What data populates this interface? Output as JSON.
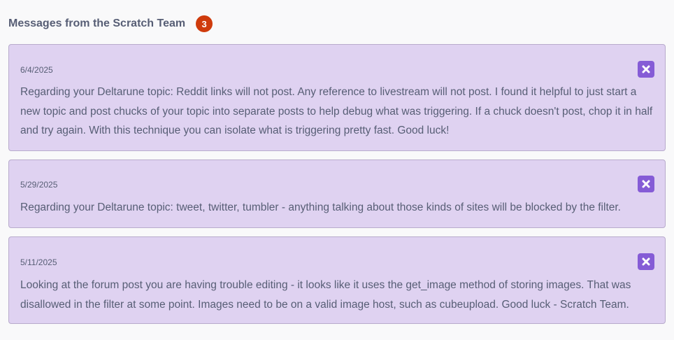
{
  "header": {
    "title": "Messages from the Scratch Team",
    "count": "3"
  },
  "messages": [
    {
      "date": "6/4/2025",
      "text": "Regarding your Deltarune topic: Reddit links will not post. Any reference to livestream will not post. I found it helpful to just start a new topic and post chucks of your topic into separate posts to help debug what was triggering. If a chuck doesn't post, chop it in half and try again. With this technique you can isolate what is triggering pretty fast. Good luck!"
    },
    {
      "date": "5/29/2025",
      "text": "Regarding your Deltarune topic: tweet, twitter, tumbler - anything talking about those kinds of sites will be blocked by the filter."
    },
    {
      "date": "5/11/2025",
      "text": "Looking at the forum post you are having trouble editing - it looks like it uses the get_image method of storing images. That was disallowed in the filter at some point. Images need to be on a valid image host, such as cubeupload. Good luck - Scratch Team."
    }
  ],
  "icons": {
    "dismiss": "close-icon"
  },
  "colors": {
    "message_background": "#dfd2f1",
    "message_border": "#b8abcc",
    "dismiss_button": "#855cd6",
    "count_badge": "#cf3b0c",
    "text": "#575e75"
  }
}
